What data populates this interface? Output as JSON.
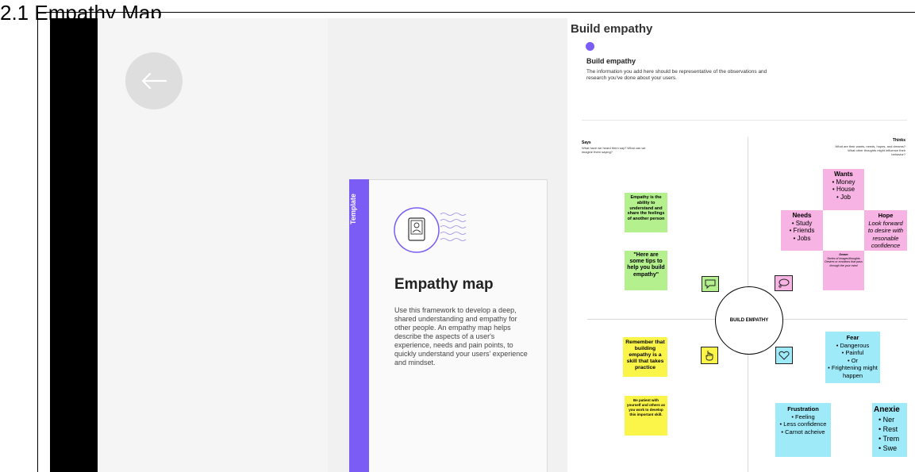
{
  "page": {
    "heading": "2.1 Empathy Map"
  },
  "left_panel": {
    "back_icon": "arrow-left-icon"
  },
  "template_card": {
    "band_label": "Template",
    "title": "Empathy map",
    "description": "Use this framework to develop a deep, shared understanding and empathy for other people. An empathy map helps describe the aspects of a user's experience, needs and pain points, to quickly understand your users' experience and mindset.",
    "accent_color": "#7b5cf5"
  },
  "board": {
    "title": "Build empathy",
    "subtitle": "Build empathy",
    "description": "The information you add here should be representative of the observations and research you've done about your users.",
    "says": {
      "title": "Says",
      "subtitle": "What have we heard them say? What can we imagine them saying?"
    },
    "thinks": {
      "title": "Thinks",
      "subtitle": "What are their wants, needs, hopes, and dreams? What other thoughts might influence their behavior?"
    },
    "center": "BUILD EMPATHY",
    "notes": {
      "empathy_def": "Empathy is the ability to understand and share the feelings of another person",
      "tips": "\"Here are some tips to help you build empathy\"",
      "remember": "Remember that building empathy is a skill that takes practice",
      "patient": "Be patient with yourself and others as you work to develop this important skill.",
      "wants": {
        "title": "Wants",
        "items": [
          "Money",
          "House",
          "Job"
        ]
      },
      "needs": {
        "title": "Needs",
        "items": [
          "Study",
          "Friends",
          "Jobs"
        ]
      },
      "hope": {
        "title": "Hope",
        "text": "Look forward to desire with resonable confidence"
      },
      "dream": {
        "title": "Dream",
        "text": "Series of images/thoughts Desires or emotions that pass through the your mind"
      },
      "fear": {
        "title": "Fear",
        "items": [
          "Dangerous",
          "Painful",
          "Or",
          "Frightening might happen"
        ]
      },
      "frustration": {
        "title": "Frustration",
        "items": [
          "Feeling",
          "Less confidence",
          "Carnot acheive"
        ]
      },
      "anxiety": {
        "title": "Anexie",
        "items": [
          "Ner",
          "Rest",
          "Trem",
          "Swe"
        ]
      }
    }
  }
}
